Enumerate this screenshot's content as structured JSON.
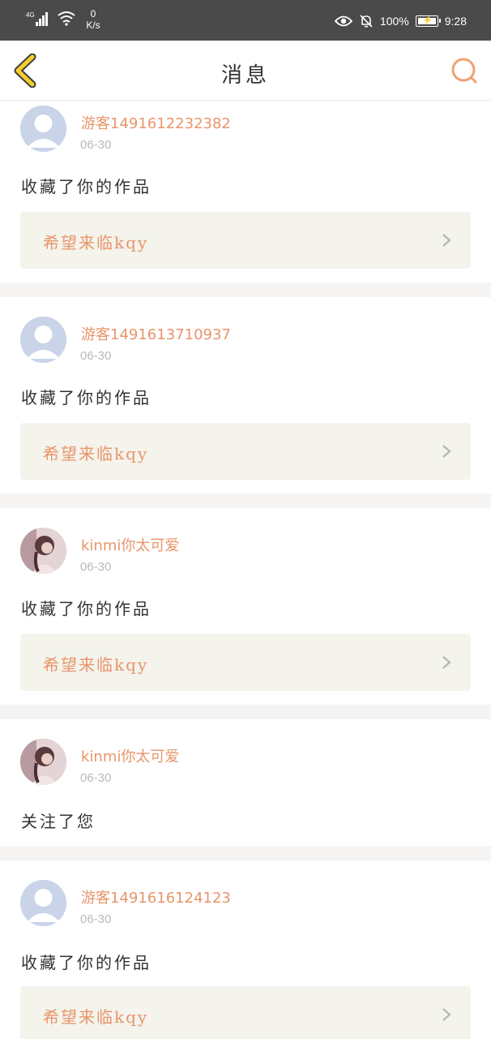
{
  "status_bar": {
    "network": "4G",
    "speed_value": "0",
    "speed_unit": "K/s",
    "battery": "100%",
    "time": "9:28",
    "icons": [
      "signal-icon",
      "wifi-icon",
      "eye-icon",
      "bell-off-icon",
      "battery-charging-icon"
    ]
  },
  "header": {
    "title": "消息",
    "back_icon": "chevron-left-icon",
    "search_icon": "search-icon",
    "accent_color": "#e8956a",
    "back_color": "#f2cf2f"
  },
  "messages": [
    {
      "avatar": "default-avatar",
      "user": "游客1491612232382",
      "date": "06-30",
      "action": "收藏了你的作品",
      "work": "希望来临kqy"
    },
    {
      "avatar": "default-avatar",
      "user": "游客1491613710937",
      "date": "06-30",
      "action": "收藏了你的作品",
      "work": "希望来临kqy"
    },
    {
      "avatar": "photo-avatar",
      "user": "kinmi你太可爱",
      "date": "06-30",
      "action": "收藏了你的作品",
      "work": "希望来临kqy"
    },
    {
      "avatar": "photo-avatar",
      "user": "kinmi你太可爱",
      "date": "06-30",
      "action": "关注了您"
    },
    {
      "avatar": "default-avatar",
      "user": "游客1491616124123",
      "date": "06-30",
      "action": "收藏了你的作品",
      "work": "希望来临kqy"
    }
  ]
}
